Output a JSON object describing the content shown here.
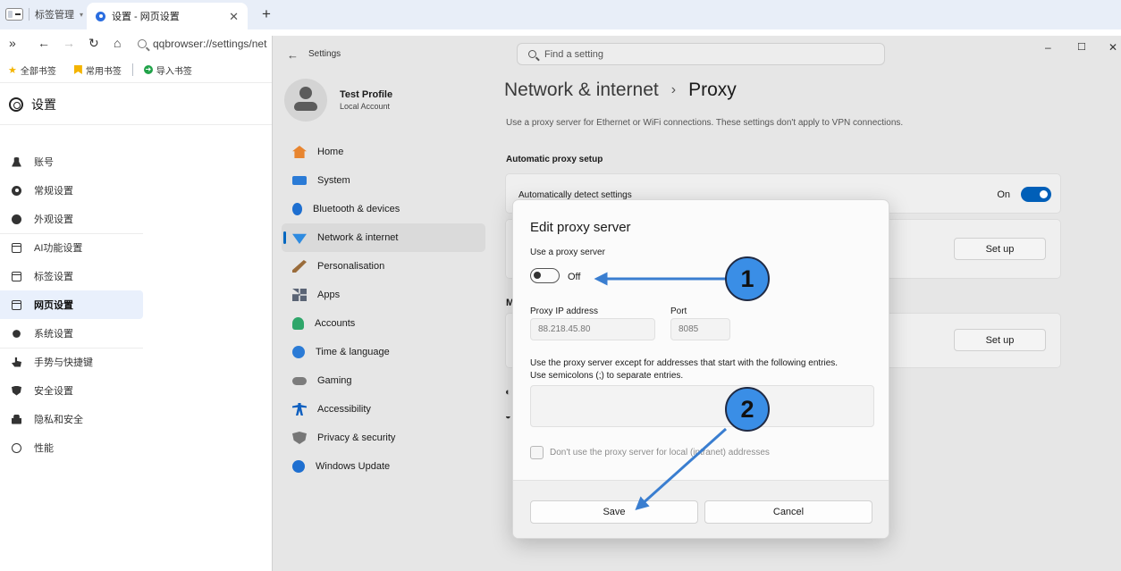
{
  "browser": {
    "tab_manager_label": "标签管理",
    "tab_manager_caret": "▾",
    "active_tab_title": "设置 - 网页设置",
    "close_glyph": "✕",
    "new_tab_glyph": "+",
    "address": "qqbrowser://settings/net",
    "nav": {
      "expand": "»",
      "back": "←",
      "forward": "→",
      "reload": "↻",
      "home": "⌂"
    },
    "bookmarks": [
      {
        "label": "全部书签",
        "icon": "star-icon"
      },
      {
        "label": "常用书签",
        "icon": "bookmark-flag-icon"
      },
      {
        "label": "导入书签",
        "icon": "import-icon"
      }
    ]
  },
  "qq_settings": {
    "title": "设置",
    "menu": [
      {
        "label": "账号",
        "icon": "user-icon"
      },
      {
        "label": "常规设置",
        "icon": "gear-icon"
      },
      {
        "label": "外观设置",
        "icon": "palette-icon"
      },
      {
        "label": "AI功能设置",
        "icon": "window-icon"
      },
      {
        "label": "标签设置",
        "icon": "window-icon"
      },
      {
        "label": "网页设置",
        "icon": "web-window-icon",
        "active": true
      },
      {
        "label": "系统设置",
        "icon": "gears-icon"
      },
      {
        "label": "手势与快捷键",
        "icon": "hand-icon"
      },
      {
        "label": "安全设置",
        "icon": "shield-icon"
      },
      {
        "label": "隐私和安全",
        "icon": "lock-icon"
      },
      {
        "label": "性能",
        "icon": "gauge-icon"
      }
    ]
  },
  "win_settings": {
    "title": "Settings",
    "back_glyph": "←",
    "search_placeholder": "Find a setting",
    "window_controls": {
      "minimize": "–",
      "maximize": "☐",
      "close": "✕"
    },
    "profile": {
      "name": "Test Profile",
      "account": "Local Account"
    },
    "nav": [
      {
        "label": "Home",
        "icon": "home-icon"
      },
      {
        "label": "System",
        "icon": "system-icon"
      },
      {
        "label": "Bluetooth & devices",
        "icon": "bluetooth-icon"
      },
      {
        "label": "Network & internet",
        "icon": "network-icon",
        "active": true
      },
      {
        "label": "Personalisation",
        "icon": "personalisation-icon"
      },
      {
        "label": "Apps",
        "icon": "apps-icon"
      },
      {
        "label": "Accounts",
        "icon": "accounts-icon"
      },
      {
        "label": "Time & language",
        "icon": "time-language-icon"
      },
      {
        "label": "Gaming",
        "icon": "gaming-icon"
      },
      {
        "label": "Accessibility",
        "icon": "accessibility-icon"
      },
      {
        "label": "Privacy & security",
        "icon": "privacy-shield-icon"
      },
      {
        "label": "Windows Update",
        "icon": "windows-update-icon"
      }
    ],
    "breadcrumb": {
      "parent": "Network & internet",
      "separator": "›",
      "current": "Proxy"
    },
    "description": "Use a proxy server for Ethernet or WiFi connections. These settings don't apply to VPN connections.",
    "auto_section": "Automatic proxy setup",
    "auto_detect": {
      "label": "Automatically detect settings",
      "state": "On"
    },
    "setup_label": "Set up",
    "manual_section_partial": "M"
  },
  "dialog": {
    "title": "Edit proxy server",
    "use_proxy_label": "Use a proxy server",
    "use_proxy_state": "Off",
    "ip_label": "Proxy IP address",
    "ip_placeholder": "88.218.45.80",
    "port_label": "Port",
    "port_placeholder": "8085",
    "exceptions_line1": "Use the proxy server except for addresses that start with the following entries.",
    "exceptions_line2": "Use semicolons (;) to separate entries.",
    "local_checkbox_label": "Don't use the proxy server for local (intranet) addresses",
    "save_label": "Save",
    "cancel_label": "Cancel"
  },
  "annotations": [
    {
      "number": "1",
      "color": "#3a8ee6"
    },
    {
      "number": "2",
      "color": "#3a8ee6"
    }
  ],
  "colors": {
    "accent": "#005fb8",
    "annotation": "#3a8ee6",
    "tab_bar": "#e8eef8"
  }
}
